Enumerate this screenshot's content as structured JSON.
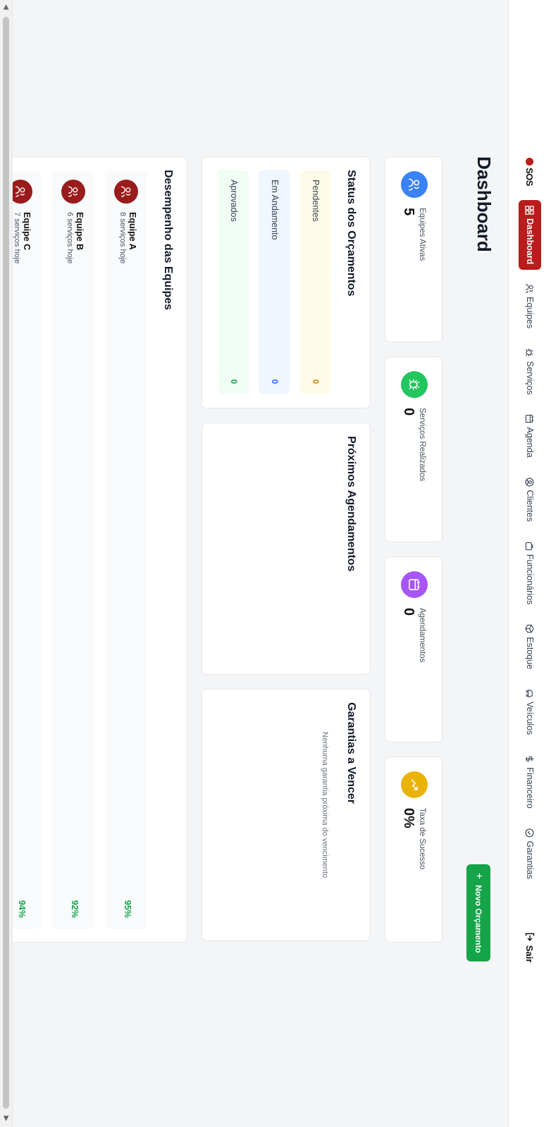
{
  "brand": {
    "name": "SOS"
  },
  "nav": {
    "items": [
      {
        "label": "Dashboard",
        "icon": "grid-icon",
        "active": true
      },
      {
        "label": "Equipes",
        "icon": "users-icon"
      },
      {
        "label": "Serviços",
        "icon": "bug-icon"
      },
      {
        "label": "Agenda",
        "icon": "calendar-icon"
      },
      {
        "label": "Clientes",
        "icon": "user-circle-icon"
      },
      {
        "label": "Funcionários",
        "icon": "briefcase-icon"
      },
      {
        "label": "Estoque",
        "icon": "box-icon"
      },
      {
        "label": "Veículos",
        "icon": "car-icon"
      },
      {
        "label": "Financeiro",
        "icon": "dollar-icon"
      },
      {
        "label": "Garantias",
        "icon": "check-circle-icon"
      }
    ],
    "logout": "Sair"
  },
  "header": {
    "title": "Dashboard",
    "new_button": "Novo Orçamento"
  },
  "stats": [
    {
      "label": "Equipes Ativas",
      "value": "5",
      "color": "#3b82f6",
      "icon": "users-icon"
    },
    {
      "label": "Serviços Realizados",
      "value": "0",
      "color": "#22c55e",
      "icon": "bug-icon"
    },
    {
      "label": "Agendamentos",
      "value": "0",
      "color": "#a855f7",
      "icon": "calendar-icon"
    },
    {
      "label": "Taxa de Sucesso",
      "value": "0%",
      "color": "#eab308",
      "icon": "trend-up-icon"
    }
  ],
  "budget_status": {
    "title": "Status dos Orçamentos",
    "rows": [
      {
        "label": "Pendentes",
        "value": "0",
        "bg": "#fefce8",
        "color": "#ca8a04"
      },
      {
        "label": "Em Andamento",
        "value": "0",
        "bg": "#eff6ff",
        "color": "#2563eb"
      },
      {
        "label": "Aprovados",
        "value": "0",
        "bg": "#f0fdf4",
        "color": "#16a34a"
      }
    ]
  },
  "appointments": {
    "title": "Próximos Agendamentos"
  },
  "warranties": {
    "title": "Garantias a Vencer",
    "empty": "Nenhuma garantia próxima do vencimento"
  },
  "team_performance": {
    "title": "Desempenho das Equipes",
    "teams": [
      {
        "name": "Equipe A",
        "subtitle": "8 serviços hoje",
        "score": "95%"
      },
      {
        "name": "Equipe B",
        "subtitle": "6 serviços hoje",
        "score": "92%"
      },
      {
        "name": "Equipe C",
        "subtitle": "7 serviços hoje",
        "score": "94%"
      }
    ]
  }
}
